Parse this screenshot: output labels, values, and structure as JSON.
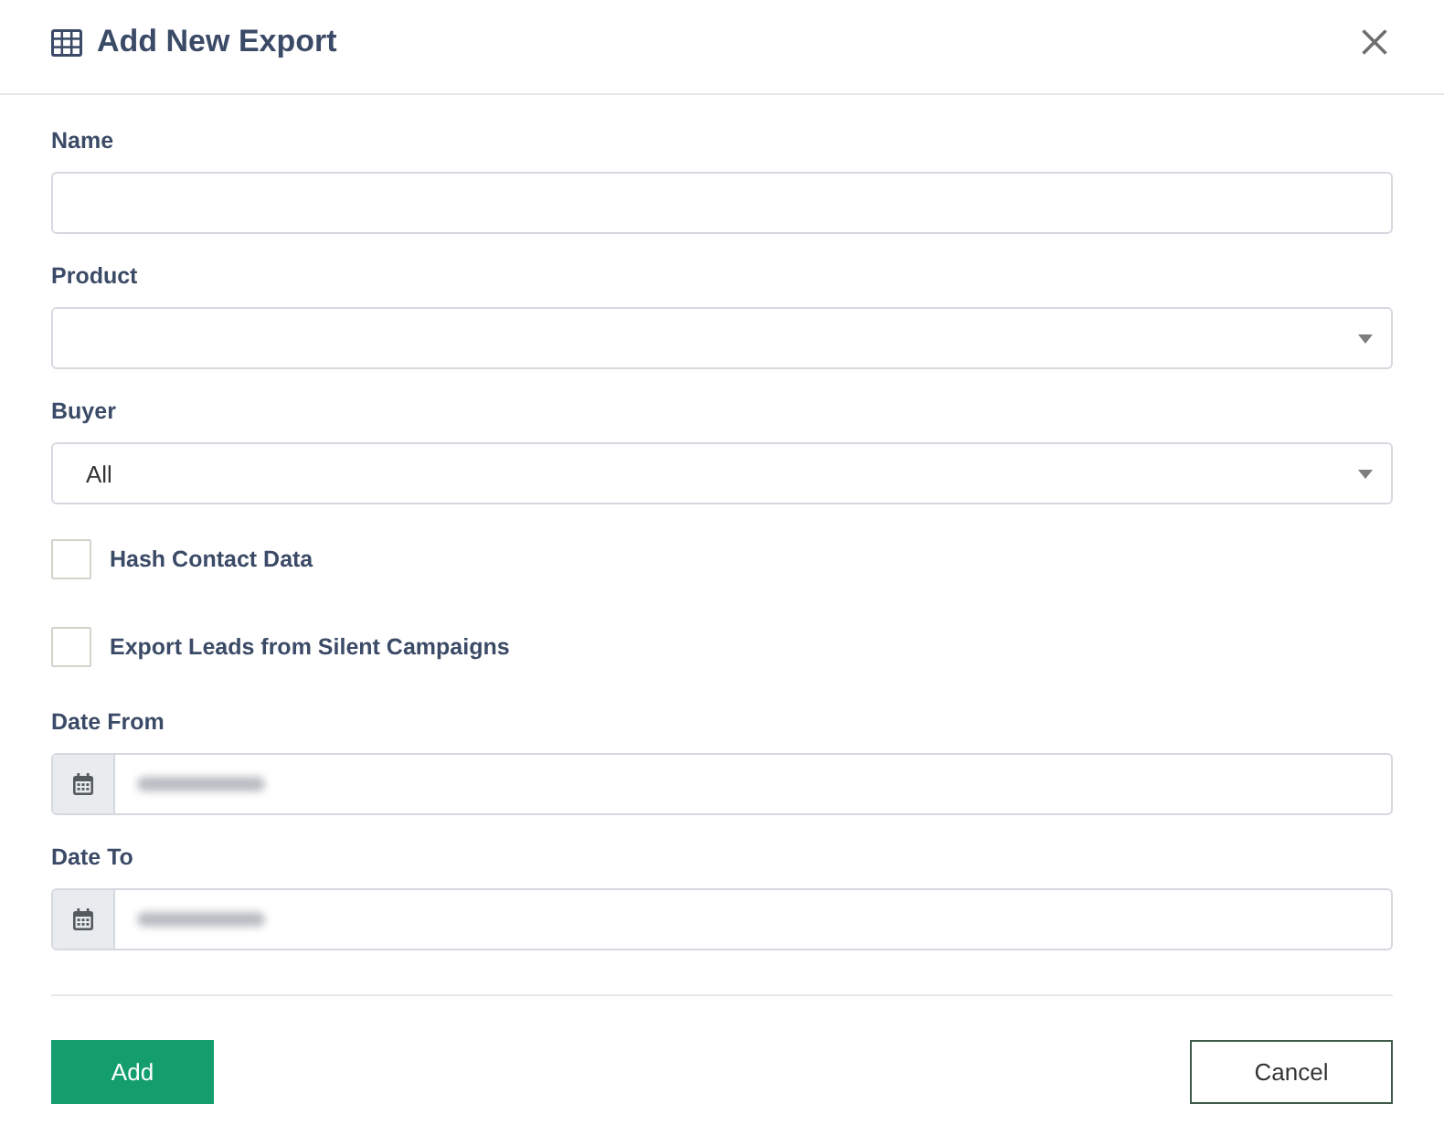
{
  "dialog": {
    "title": "Add New Export"
  },
  "fields": [
    {
      "kind": "text",
      "label": "Name"
    },
    {
      "kind": "select",
      "label": "Product"
    },
    {
      "kind": "select",
      "label": "Buyer",
      "value": "All"
    },
    {
      "kind": "checkbox",
      "label": "Hash Contact Data",
      "checked": false
    },
    {
      "kind": "checkbox",
      "label": "Export Leads from Silent Campaigns",
      "checked": false
    },
    {
      "kind": "date",
      "label": "Date From",
      "value_blurred": true
    },
    {
      "kind": "date",
      "label": "Date To",
      "value_blurred": true
    }
  ],
  "buttons": [
    {
      "kind": "primary",
      "label": "Add"
    },
    {
      "kind": "secondary",
      "label": "Cancel"
    }
  ]
}
